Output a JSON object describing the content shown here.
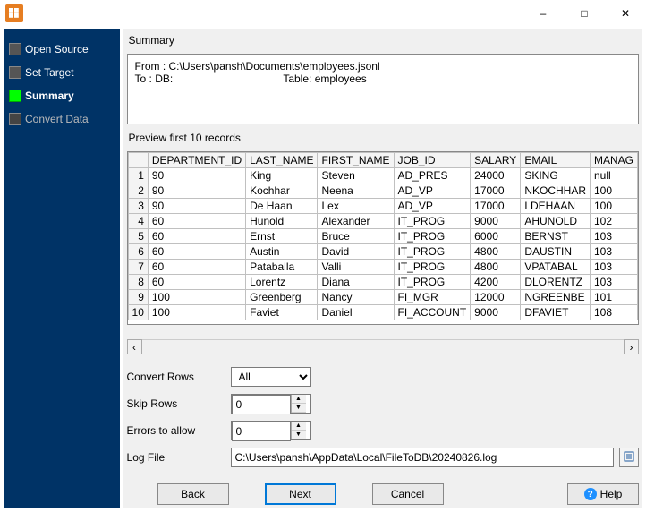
{
  "window": {
    "minimize": "–",
    "maximize": "□",
    "close": "✕"
  },
  "sidebar": {
    "items": [
      {
        "label": "Open Source"
      },
      {
        "label": "Set Target"
      },
      {
        "label": "Summary"
      },
      {
        "label": "Convert Data"
      }
    ]
  },
  "summary": {
    "heading": "Summary",
    "text": "From : C:\\Users\\pansh\\Documents\\employees.jsonl\nTo : DB:                                     Table: employees"
  },
  "preview": {
    "heading": "Preview first 10 records",
    "columns": [
      "DEPARTMENT_ID",
      "LAST_NAME",
      "FIRST_NAME",
      "JOB_ID",
      "SALARY",
      "EMAIL",
      "MANAG"
    ],
    "rows": [
      [
        "90",
        "King",
        "Steven",
        "AD_PRES",
        "24000",
        "SKING",
        "null"
      ],
      [
        "90",
        "Kochhar",
        "Neena",
        "AD_VP",
        "17000",
        "NKOCHHAR",
        "100"
      ],
      [
        "90",
        "De Haan",
        "Lex",
        "AD_VP",
        "17000",
        "LDEHAAN",
        "100"
      ],
      [
        "60",
        "Hunold",
        "Alexander",
        "IT_PROG",
        "9000",
        "AHUNOLD",
        "102"
      ],
      [
        "60",
        "Ernst",
        "Bruce",
        "IT_PROG",
        "6000",
        "BERNST",
        "103"
      ],
      [
        "60",
        "Austin",
        "David",
        "IT_PROG",
        "4800",
        "DAUSTIN",
        "103"
      ],
      [
        "60",
        "Pataballa",
        "Valli",
        "IT_PROG",
        "4800",
        "VPATABAL",
        "103"
      ],
      [
        "60",
        "Lorentz",
        "Diana",
        "IT_PROG",
        "4200",
        "DLORENTZ",
        "103"
      ],
      [
        "100",
        "Greenberg",
        "Nancy",
        "FI_MGR",
        "12000",
        "NGREENBE",
        "101"
      ],
      [
        "100",
        "Faviet",
        "Daniel",
        "FI_ACCOUNT",
        "9000",
        "DFAVIET",
        "108"
      ]
    ]
  },
  "form": {
    "convert_rows_label": "Convert Rows",
    "convert_rows_value": "All",
    "skip_rows_label": "Skip Rows",
    "skip_rows_value": "0",
    "errors_label": "Errors to allow",
    "errors_value": "0",
    "log_label": "Log File",
    "log_value": "C:\\Users\\pansh\\AppData\\Local\\FileToDB\\20240826.log"
  },
  "buttons": {
    "back": "Back",
    "next": "Next",
    "cancel": "Cancel",
    "help": "Help"
  }
}
